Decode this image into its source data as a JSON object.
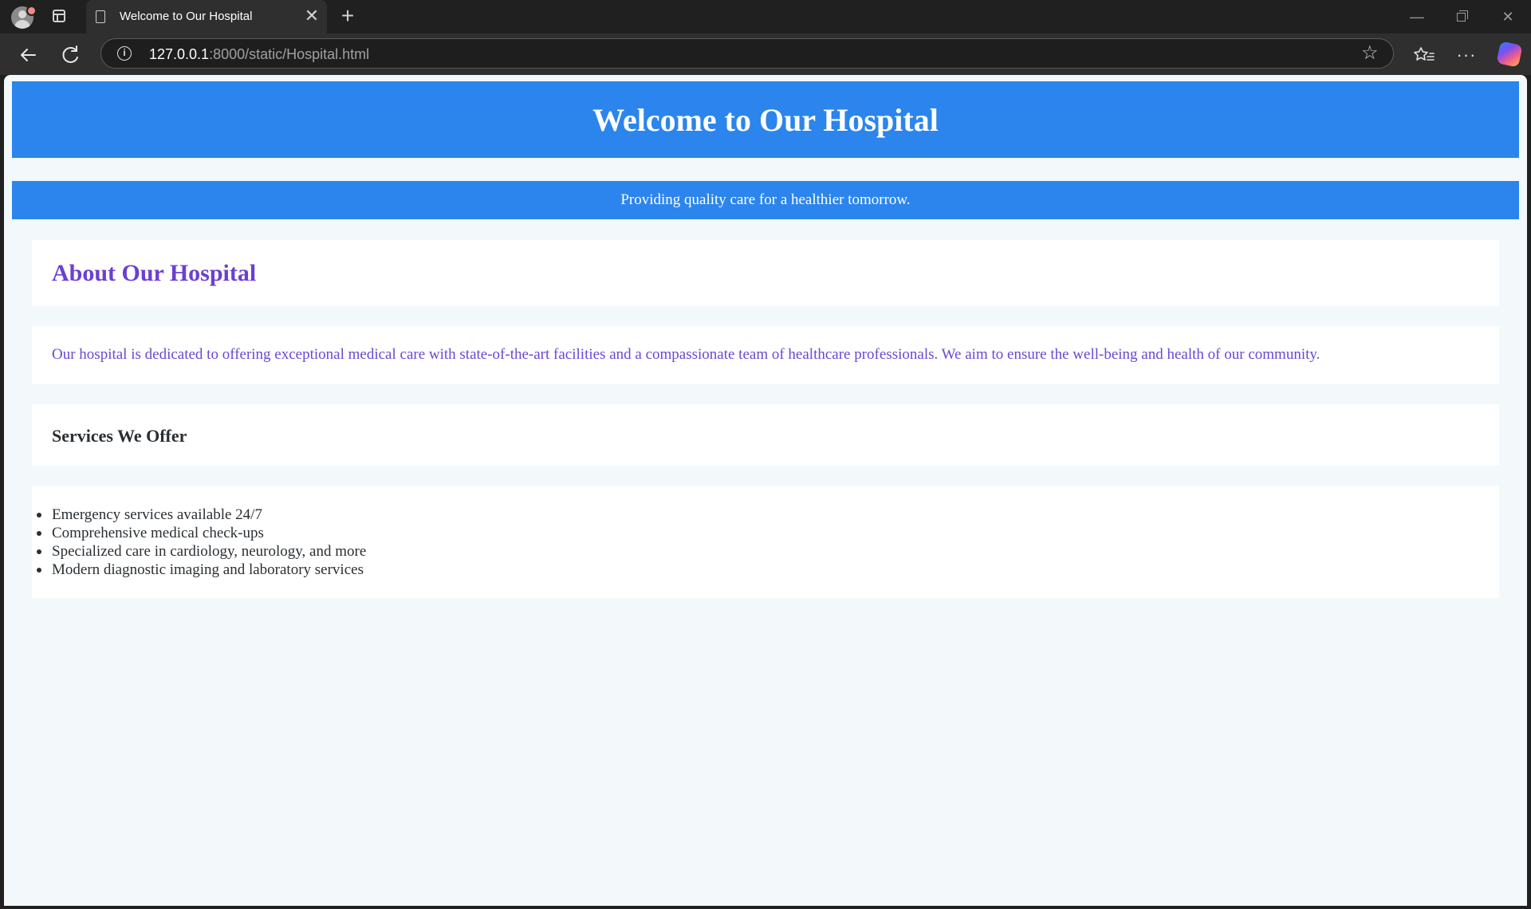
{
  "browser": {
    "tab_title": "Welcome to Our Hospital",
    "tab_close_glyph": "✕",
    "new_tab_glyph": "+",
    "url_host": "127.0.0.1",
    "url_path": ":8000/static/Hospital.html",
    "icons": [
      "profile-avatar",
      "tab-actions-icon",
      "page-icon",
      "back-arrow-icon",
      "refresh-icon",
      "site-info-icon",
      "star-icon",
      "favorites-icon",
      "more-icon",
      "copilot-icon"
    ],
    "window_controls": {
      "minimize": "—",
      "close": "✕"
    }
  },
  "page": {
    "colors": {
      "header_bg": "#2b85ec",
      "page_bg": "#f3f8fa",
      "card_bg": "#ffffff",
      "accent_purple": "#6c3fd1",
      "text_dark": "#2a2f33"
    },
    "header": {
      "title": "Welcome to Our Hospital"
    },
    "tagline": "Providing quality care for a healthier tomorrow.",
    "about": {
      "heading": "About Our Hospital",
      "description": "Our hospital is dedicated to offering exceptional medical care with state-of-the-art facilities and a compassionate team of healthcare professionals. We aim to ensure the well-being and health of our community."
    },
    "services": {
      "heading": "Services We Offer",
      "items": [
        "Emergency services available 24/7",
        "Comprehensive medical check-ups",
        "Specialized care in cardiology, neurology, and more",
        "Modern diagnostic imaging and laboratory services"
      ]
    }
  }
}
